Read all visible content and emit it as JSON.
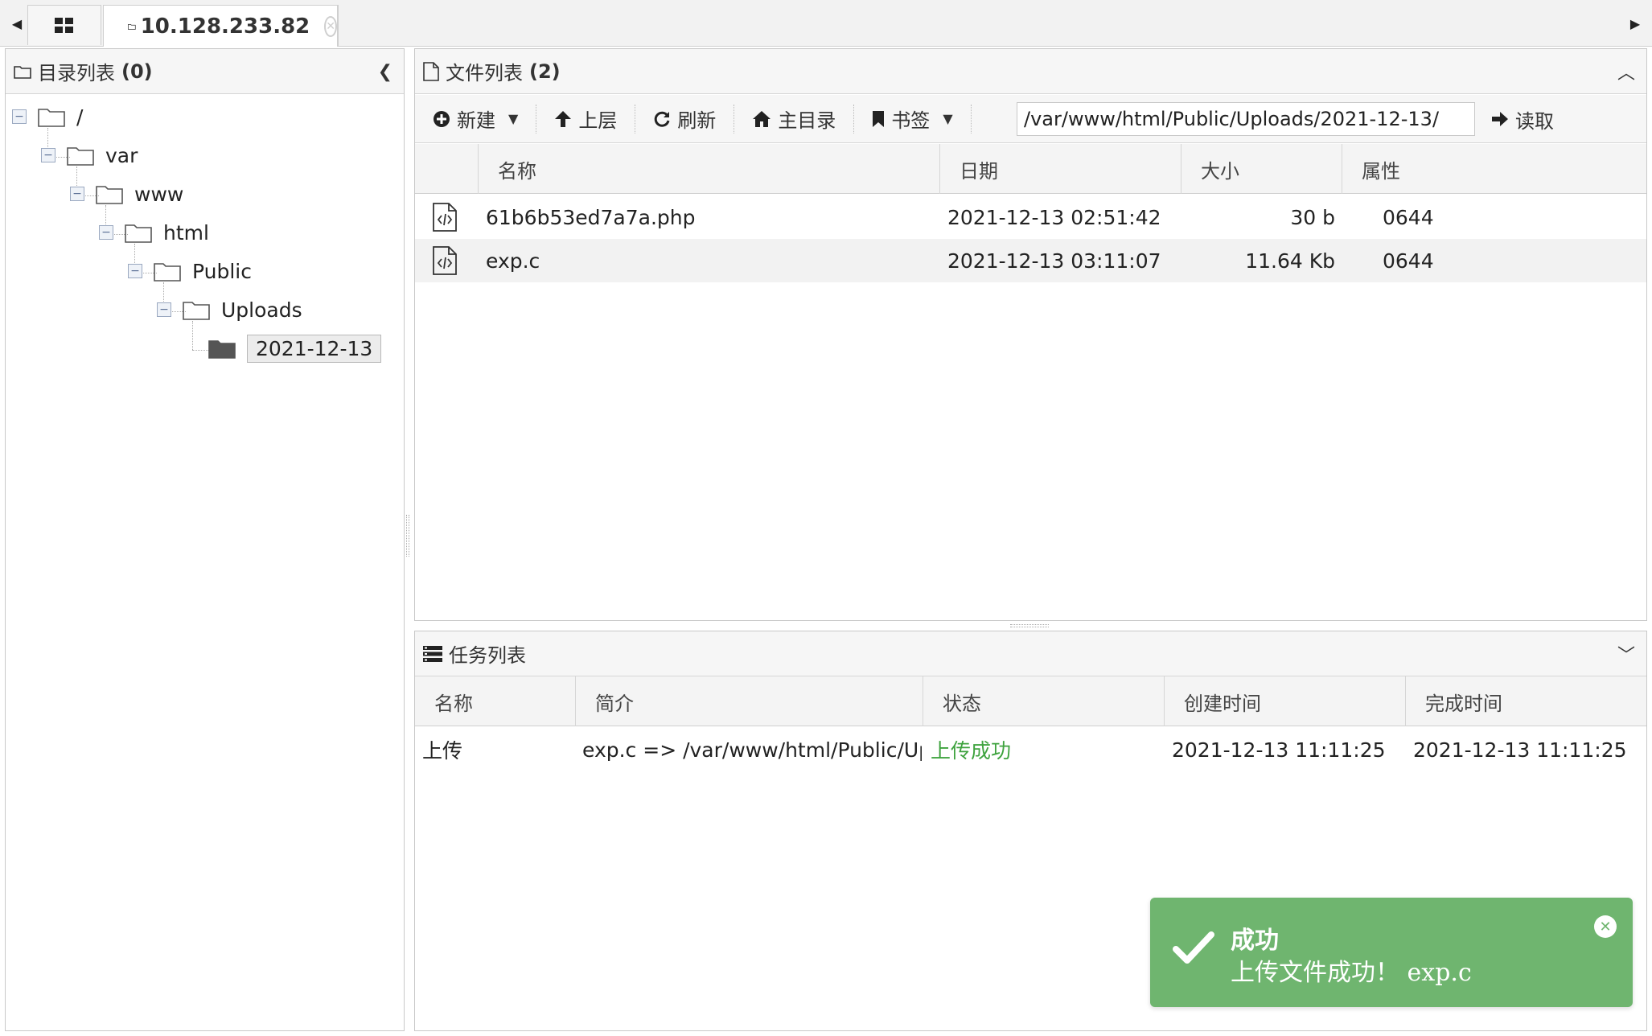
{
  "tabs": {
    "active_label": "10.128.233.82"
  },
  "dir_panel": {
    "title": "目录列表",
    "count": "(0)",
    "tree": [
      {
        "label": "/",
        "level": 0
      },
      {
        "label": "var",
        "level": 1
      },
      {
        "label": "www",
        "level": 2
      },
      {
        "label": "html",
        "level": 3
      },
      {
        "label": "Public",
        "level": 4
      },
      {
        "label": "Uploads",
        "level": 5
      },
      {
        "label": "2021-12-13",
        "level": 6,
        "selected": true
      }
    ]
  },
  "file_panel": {
    "title": "文件列表",
    "count": "(2)",
    "toolbar": {
      "new_label": "新建",
      "up_label": "上层",
      "refresh_label": "刷新",
      "home_label": "主目录",
      "bookmark_label": "书签",
      "path_value": "/var/www/html/Public/Uploads/2021-12-13/",
      "read_label": "读取"
    },
    "columns": {
      "name": "名称",
      "date": "日期",
      "size": "大小",
      "attr": "属性"
    },
    "rows": [
      {
        "name": "61b6b53ed7a7a.php",
        "date": "2021-12-13 02:51:42",
        "size": "30 b",
        "attr": "0644"
      },
      {
        "name": "exp.c",
        "date": "2021-12-13 03:11:07",
        "size": "11.64 Kb",
        "attr": "0644"
      }
    ]
  },
  "task_panel": {
    "title": "任务列表",
    "columns": {
      "name": "名称",
      "desc": "简介",
      "status": "状态",
      "created": "创建时间",
      "finished": "完成时间"
    },
    "rows": [
      {
        "name": "上传",
        "desc": "exp.c => /var/www/html/Public/Uplc",
        "status": "上传成功",
        "created": "2021-12-13 11:11:25",
        "finished": "2021-12-13 11:11:25"
      }
    ]
  },
  "toast": {
    "title": "成功",
    "message": "上传文件成功！ exp.c",
    "color": "#6fb56f"
  }
}
